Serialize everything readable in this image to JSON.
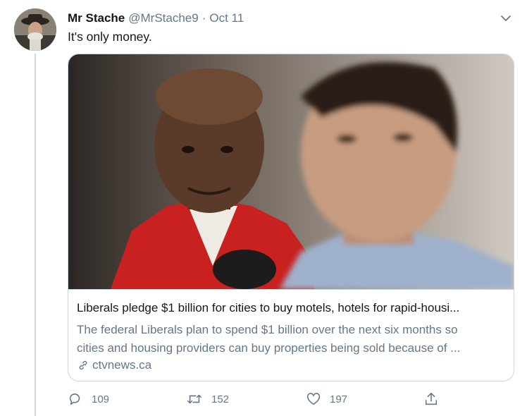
{
  "tweet": {
    "author_name": "Mr Stache",
    "handle": "@MrStache9",
    "separator": "·",
    "date": "Oct 11",
    "text": "It's only money."
  },
  "card": {
    "title": "Liberals pledge $1 billion for cities to buy motels, hotels for rapid-housi...",
    "description_line1": "The federal Liberals plan to spend $1 billion over the next six months so",
    "description_line2": "cities and housing providers can buy properties being sold because of ...",
    "domain": "ctvnews.ca"
  },
  "actions": {
    "reply_count": "109",
    "retweet_count": "152",
    "like_count": "197"
  },
  "icons": [
    "chevron-down-icon",
    "link-icon",
    "reply-icon",
    "retweet-icon",
    "like-icon",
    "share-icon"
  ],
  "colors": {
    "secondary_text": "#657786",
    "border": "#ccd6dd",
    "thread_line": "#cfd9de"
  }
}
